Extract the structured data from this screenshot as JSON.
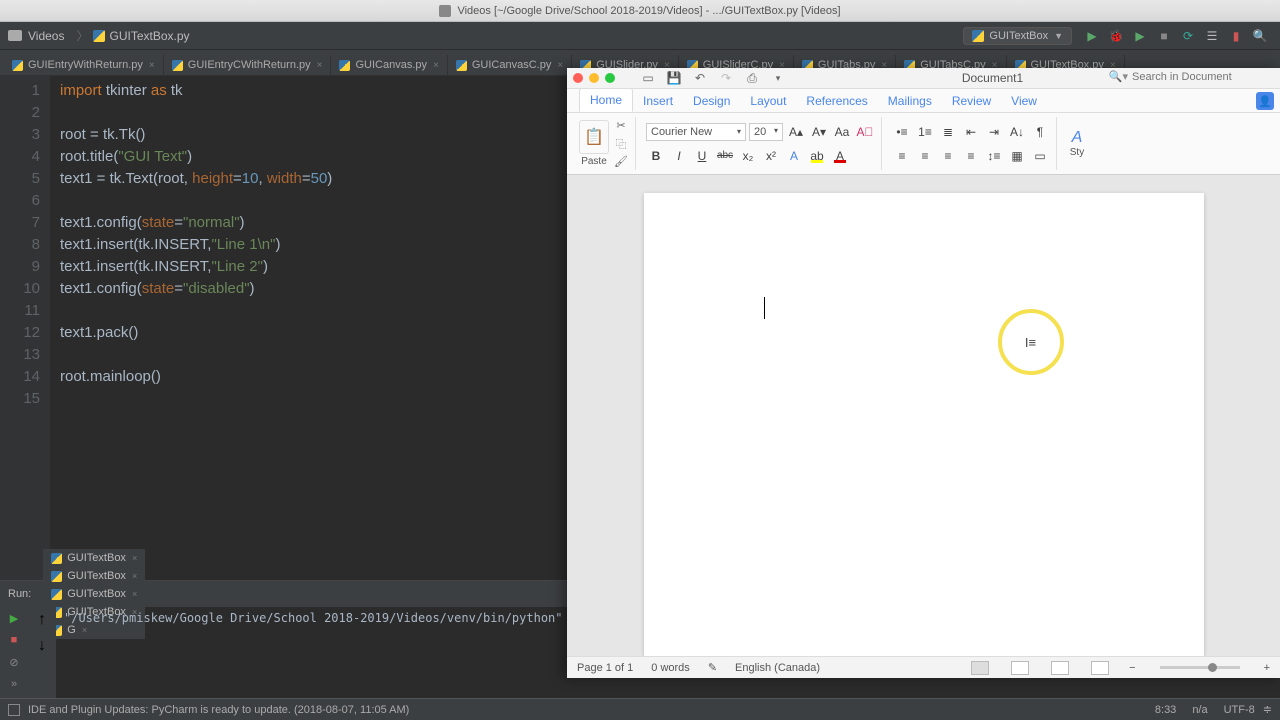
{
  "titlebar": "Videos [~/Google Drive/School 2018-2019/Videos] - .../GUITextBox.py [Videos]",
  "breadcrumb": {
    "folder": "Videos",
    "file": "GUITextBox.py"
  },
  "run_config": "GUITextBox",
  "editor_tabs": [
    "GUIEntryWithReturn.py",
    "GUIEntryCWithReturn.py",
    "GUICanvas.py",
    "GUICanvasC.py",
    "GUISlider.py",
    "GUISliderC.py",
    "GUITabs.py",
    "GUITabsC.py",
    "GUITextBox.py"
  ],
  "line_count": 15,
  "code_lines": [
    [
      [
        "kw",
        "import"
      ],
      [
        "",
        " tkinter "
      ],
      [
        "kw",
        "as"
      ],
      [
        "",
        " tk"
      ]
    ],
    [],
    [
      [
        "",
        "root = tk.Tk()"
      ]
    ],
    [
      [
        "",
        "root.title("
      ],
      [
        "str",
        "\"GUI Text\""
      ],
      [
        "",
        ")"
      ]
    ],
    [
      [
        "",
        "text1 = tk.Text(root, "
      ],
      [
        "param",
        "height"
      ],
      [
        "",
        "="
      ],
      [
        "num",
        "10"
      ],
      [
        "",
        ", "
      ],
      [
        "param",
        "width"
      ],
      [
        "",
        "="
      ],
      [
        "num",
        "50"
      ],
      [
        "",
        ")"
      ]
    ],
    [],
    [
      [
        "",
        "text1.config("
      ],
      [
        "param",
        "state"
      ],
      [
        "",
        "="
      ],
      [
        "str",
        "\"normal\""
      ],
      [
        "",
        ")"
      ]
    ],
    [
      [
        "",
        "text1.insert(tk.INSERT,"
      ],
      [
        "str",
        "\"Line 1\\n\""
      ],
      [
        "",
        ")"
      ]
    ],
    [
      [
        "",
        "text1.insert(tk.INSERT,"
      ],
      [
        "str",
        "\"Line 2\""
      ],
      [
        "",
        ")"
      ]
    ],
    [
      [
        "",
        "text1.config("
      ],
      [
        "param",
        "state"
      ],
      [
        "",
        "="
      ],
      [
        "str",
        "\"disabled\""
      ],
      [
        "",
        ")"
      ]
    ],
    [],
    [
      [
        "",
        "text1.pack()"
      ]
    ],
    [],
    [
      [
        "",
        "root.mainloop()"
      ]
    ],
    []
  ],
  "run_label": "Run:",
  "run_tabs": [
    "GUITextBox",
    "GUITextBox",
    "GUITextBox",
    "GUITextBox",
    "G"
  ],
  "run_output": "\"/Users/pmiskew/Google Drive/School 2018-2019/Videos/venv/bin/python\"",
  "status_msg": "IDE and Plugin Updates: PyCharm is ready to update. (2018-08-07, 11:05 AM)",
  "status_right": {
    "pos": "8:33",
    "na": "n/a",
    "enc": "UTF-8"
  },
  "word": {
    "title": "Document1",
    "search_placeholder": "Search in Document",
    "tabs": [
      "Home",
      "Insert",
      "Design",
      "Layout",
      "References",
      "Mailings",
      "Review",
      "View"
    ],
    "active_tab": 0,
    "paste": "Paste",
    "font": "Courier New",
    "size": "20",
    "status": {
      "page": "Page 1 of 1",
      "words": "0 words",
      "lang": "English (Canada)"
    },
    "styles": "Sty"
  }
}
